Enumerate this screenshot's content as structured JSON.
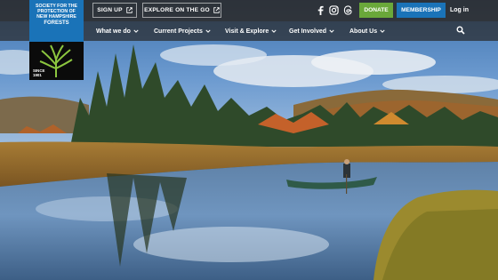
{
  "logo": {
    "name_lines": [
      "SOCIETY FOR THE",
      "PROTECTION OF",
      "NEW HAMPSHIRE"
    ],
    "name_big": "FORESTS",
    "since_line1": "SINCE",
    "since_line2": "1901"
  },
  "top_buttons": {
    "sign_up": "SIGN UP",
    "explore": "EXPLORE ON THE GO",
    "donate": "DONATE",
    "membership": "MEMBERSHIP",
    "login": "Log in"
  },
  "social": [
    "facebook-icon",
    "instagram-icon",
    "threads-icon"
  ],
  "nav": {
    "items": [
      {
        "label": "What we do"
      },
      {
        "label": "Current Projects"
      },
      {
        "label": "Visit & Explore"
      },
      {
        "label": "Get Involved"
      },
      {
        "label": "About Us"
      }
    ]
  },
  "colors": {
    "donate": "#6aa83a",
    "membership": "#1a73b8",
    "logo_blue": "#1a73b8",
    "logo_tree": "#8cc63f"
  }
}
